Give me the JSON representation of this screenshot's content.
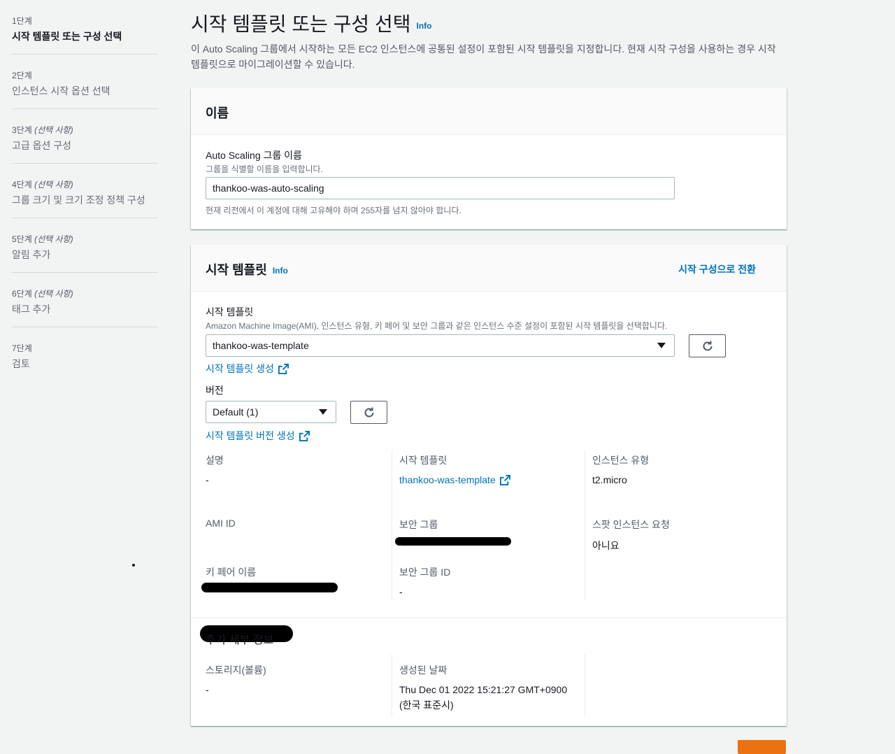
{
  "sidebar": {
    "steps": [
      {
        "num": "1단계",
        "opt": "",
        "label": "시작 템플릿 또는 구성 선택"
      },
      {
        "num": "2단계",
        "opt": "",
        "label": "인스턴스 시작 옵션 선택"
      },
      {
        "num": "3단계",
        "opt": "(선택 사항)",
        "label": "고급 옵션 구성"
      },
      {
        "num": "4단계",
        "opt": "(선택 사항)",
        "label": "그룹 크기 및 크기 조정 정책 구성"
      },
      {
        "num": "5단계",
        "opt": "(선택 사항)",
        "label": "알림 추가"
      },
      {
        "num": "6단계",
        "opt": "(선택 사항)",
        "label": "태그 추가"
      },
      {
        "num": "7단계",
        "opt": "",
        "label": "검토"
      }
    ]
  },
  "page": {
    "title": "시작 템플릿 또는 구성 선택",
    "info": "Info",
    "description": "이 Auto Scaling 그룹에서 시작하는 모든 EC2 인스턴스에 공통된 설정이 포함된 시작 템플릿을 지정합니다. 현재 시작 구성을 사용하는 경우 시작 템플릿으로 마이그레이션할 수 있습니다."
  },
  "name_panel": {
    "title": "이름",
    "field_label": "Auto Scaling 그룹 이름",
    "field_desc": "그룹을 식별할 이름을 입력합니다.",
    "field_value": "thankoo-was-auto-scaling",
    "field_hint": "현재 리전에서 이 계정에 대해 고유해야 하며 255자를 넘지 않아야 합니다."
  },
  "template_panel": {
    "title": "시작 템플릿",
    "info": "Info",
    "switch_link": "시작 구성으로 전환",
    "template_label": "시작 템플릿",
    "template_desc": "Amazon Machine Image(AMI), 인스턴스 유형, 키 페어 및 보안 그룹과 같은 인스턴스 수준 설정이 포함된 시작 템플릿을 선택합니다.",
    "template_value": "thankoo-was-template",
    "create_template_link": "시작 템플릿 생성",
    "version_label": "버전",
    "version_value": "Default (1)",
    "create_version_link": "시작 템플릿 버전 생성",
    "details": {
      "desc_label": "설명",
      "desc_value": "-",
      "tmpl_label": "시작 템플릿",
      "tmpl_value": "thankoo-was-template",
      "itype_label": "인스턴스 유형",
      "itype_value": "t2.micro",
      "ami_label": "AMI ID",
      "sg_label": "보안 그룹",
      "sg_value": "-",
      "spot_label": "스팟 인스턴스 요청",
      "spot_value": "아니요",
      "key_label": "키 페어 이름",
      "sgid_label": "보안 그룹 ID",
      "sgid_value": "-"
    },
    "extra": {
      "title": "추가 세부 정보",
      "storage_label": "스토리지(볼륨)",
      "storage_value": "-",
      "created_label": "생성된 날짜",
      "created_value_1": "Thu Dec 01 2022 15:21:27 GMT+0900",
      "created_value_2": "(한국 표준시)"
    }
  },
  "colors": {
    "link": "#0073bb",
    "primary_button": "#ec7211",
    "redaction": "#000000"
  },
  "icons": [
    "external-link-icon",
    "refresh-icon",
    "caret-down-icon"
  ]
}
